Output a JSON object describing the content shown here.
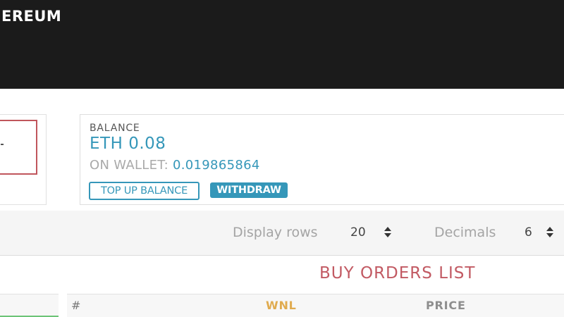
{
  "header": {
    "brand": "EREUM"
  },
  "balance": {
    "label": "BALANCE",
    "value": "ETH 0.08",
    "wallet_label": "ON WALLET:",
    "wallet_value": "0.019865864",
    "topup_label": "TOP UP BALANCE",
    "withdraw_label": "WITHDRAW"
  },
  "controls": {
    "display_rows_label": "Display rows",
    "display_rows_value": "20",
    "decimals_label": "Decimals",
    "decimals_value": "6"
  },
  "orders": {
    "title": "BUY ORDERS LIST",
    "columns": [
      "#",
      "WNL",
      "PRICE"
    ]
  },
  "colors": {
    "accent": "#3597b9",
    "title_red": "#c25a63",
    "token_gold": "#e0ab4f",
    "header_bg": "#1b1b1b"
  },
  "icons": {
    "stepper": "up-down-arrows-icon"
  }
}
